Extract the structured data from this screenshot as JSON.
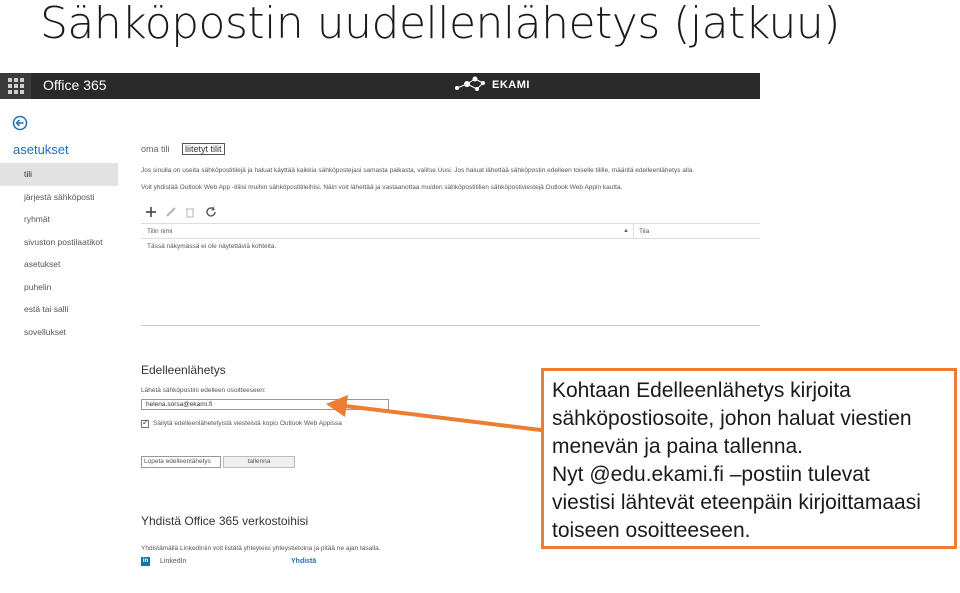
{
  "slide": {
    "title": "Sähköpostin uudellenlähetys (jatkuu)"
  },
  "colors": {
    "o365_bar": "#2a2a2a",
    "accent_blue": "#1e6fb8",
    "callout_border": "#ed7d31",
    "nav_active": "#e2e2e2"
  },
  "topbar": {
    "app_name": "Office 365",
    "logo_text": "EKAMI"
  },
  "settings": {
    "title": "asetukset",
    "nav_items": [
      {
        "label": "tili",
        "active": true
      },
      {
        "label": "järjestä sähköposti",
        "active": false
      },
      {
        "label": "ryhmät",
        "active": false
      },
      {
        "label": "sivuston postilaatikot",
        "active": false
      },
      {
        "label": "asetukset",
        "active": false
      },
      {
        "label": "puhelin",
        "active": false
      },
      {
        "label": "estä tai salli",
        "active": false
      },
      {
        "label": "sovellukset",
        "active": false
      }
    ]
  },
  "tabs": {
    "items": [
      {
        "label": "oma tili",
        "active": false
      },
      {
        "label": "liitetyt tilit",
        "active": true
      }
    ]
  },
  "connected": {
    "desc1": "Jos sinulla on useita sähköpostitilejä ja haluat käyttää kaikkia sähköpostejasi samasta paikasta, valitse Uusi. Jos haluat lähettää sähköpostin edelleen toiselle tilille, määritä edelleenlähetys alla.",
    "desc2": "Voit yhdistää Outlook Web App -tiliisi muihin sähköpostitileihisi. Näin voit lähettää ja vastaanottaa muiden sähköpostitilien sähköpostiviestejä Outlook Web Appin kautta.",
    "col_name": "Tilin nimi",
    "col_state": "Tila",
    "empty_message": "Tässä näkymässä ei ole näytettäviä kohteita."
  },
  "forwarding": {
    "title": "Edelleenlähetys",
    "label": "Lähetä sähköpostini edelleen osoitteeseen:",
    "address": "helena.sorsa@ekami.fi",
    "keep_copy_label": "Säilytä edelleenlähetetyistä viesteistä kopio Outlook Web Appissa",
    "keep_copy_checked": true,
    "stop_button": "Lopeta edelleenlähetys",
    "save_button": "tallenna"
  },
  "social": {
    "title": "Yhdistä Office 365 verkostoihisi",
    "desc": "Yhdistämällä LinkedIniin voit listätä yhteyteisi yhteystietoina ja pitää ne ajan tasalla.",
    "network": "LinkedIn",
    "connect": "Yhdistä"
  },
  "callout": {
    "lines": [
      "Kohtaan Edelleenlähetys kirjoita",
      "sähköpostiosoite, johon haluat viestien",
      "menevän ja paina tallenna.",
      "Nyt @edu.ekami.fi –postiin tulevat",
      "viestisi lähtevät eteenpäin kirjoittamaasi",
      "toiseen osoitteeseen."
    ]
  }
}
